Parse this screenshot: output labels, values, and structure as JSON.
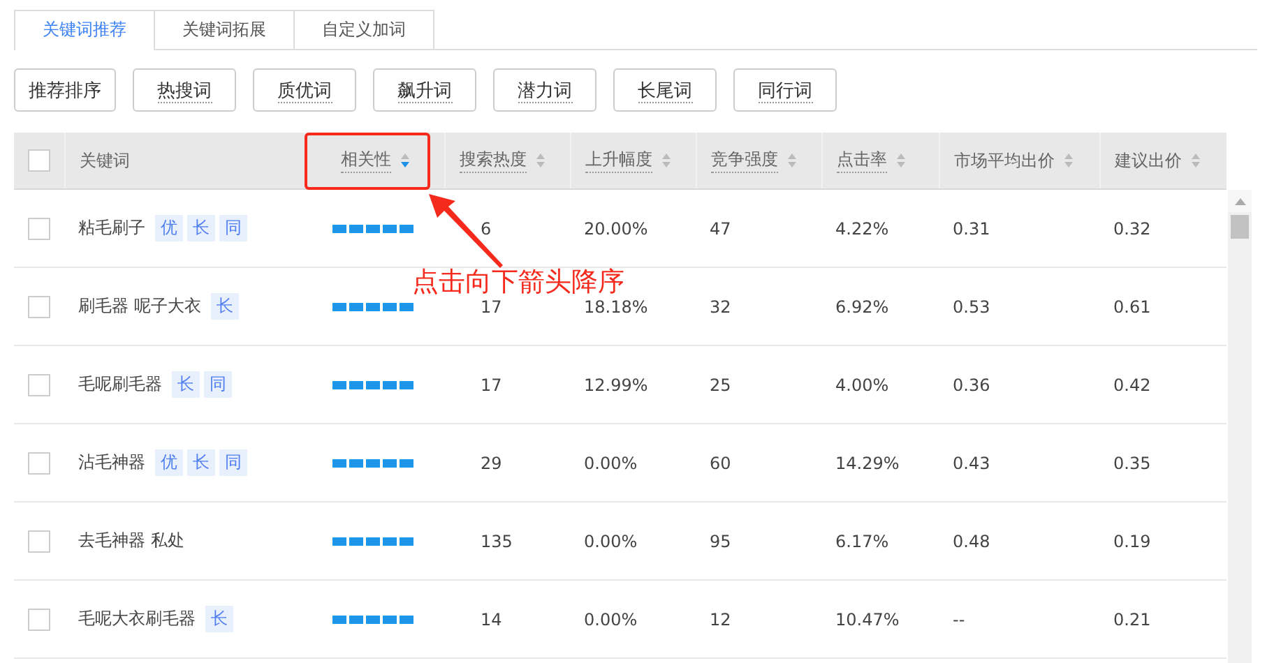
{
  "tabs": [
    {
      "label": "关键词推荐",
      "selected": true
    },
    {
      "label": "关键词拓展",
      "selected": false
    },
    {
      "label": "自定义加词",
      "selected": false
    }
  ],
  "filters": [
    {
      "label": "推荐排序",
      "hint": false
    },
    {
      "label": "热搜词",
      "hint": true
    },
    {
      "label": "质优词",
      "hint": true
    },
    {
      "label": "飙升词",
      "hint": true
    },
    {
      "label": "潜力词",
      "hint": true
    },
    {
      "label": "长尾词",
      "hint": true
    },
    {
      "label": "同行词",
      "hint": true
    }
  ],
  "table": {
    "all_checked": false,
    "columns": [
      {
        "label": "关键词",
        "hint": false,
        "sortable": false
      },
      {
        "label": "相关性",
        "hint": true,
        "sortable": true,
        "sorted_desc": true
      },
      {
        "label": "搜索热度",
        "hint": true,
        "sortable": true,
        "sorted_desc": false
      },
      {
        "label": "上升幅度",
        "hint": true,
        "sortable": true,
        "sorted_desc": false
      },
      {
        "label": "竞争强度",
        "hint": true,
        "sortable": true,
        "sorted_desc": false
      },
      {
        "label": "点击率",
        "hint": true,
        "sortable": true,
        "sorted_desc": false
      },
      {
        "label": "市场平均出价",
        "hint": false,
        "sortable": true,
        "sorted_desc": false
      },
      {
        "label": "建议出价",
        "hint": false,
        "sortable": true,
        "sorted_desc": false
      }
    ],
    "rows": [
      {
        "checked": false,
        "keyword": "粘毛刷子",
        "tags": [
          "优",
          "长",
          "同"
        ],
        "stars": 5,
        "heat": "6",
        "rise": "20.00%",
        "competition": "47",
        "ctr": "4.22%",
        "market_bid": "0.31",
        "suggested_bid": "0.32"
      },
      {
        "checked": false,
        "keyword": "刷毛器 呢子大衣",
        "tags": [
          "长"
        ],
        "stars": 5,
        "heat": "17",
        "rise": "18.18%",
        "competition": "32",
        "ctr": "6.92%",
        "market_bid": "0.53",
        "suggested_bid": "0.61"
      },
      {
        "checked": false,
        "keyword": "毛呢刷毛器",
        "tags": [
          "长",
          "同"
        ],
        "stars": 5,
        "heat": "17",
        "rise": "12.99%",
        "competition": "25",
        "ctr": "4.00%",
        "market_bid": "0.36",
        "suggested_bid": "0.42"
      },
      {
        "checked": false,
        "keyword": "沾毛神器",
        "tags": [
          "优",
          "长",
          "同"
        ],
        "stars": 5,
        "heat": "29",
        "rise": "0.00%",
        "competition": "60",
        "ctr": "14.29%",
        "market_bid": "0.43",
        "suggested_bid": "0.35"
      },
      {
        "checked": false,
        "keyword": "去毛神器 私处",
        "tags": [],
        "stars": 5,
        "heat": "135",
        "rise": "0.00%",
        "competition": "95",
        "ctr": "6.17%",
        "market_bid": "0.48",
        "suggested_bid": "0.19"
      },
      {
        "checked": false,
        "keyword": "毛呢大衣刷毛器",
        "tags": [
          "长"
        ],
        "stars": 5,
        "heat": "14",
        "rise": "0.00%",
        "competition": "12",
        "ctr": "10.47%",
        "market_bid": "--",
        "suggested_bid": "0.21"
      }
    ]
  },
  "annotation": {
    "text": "点击向下箭头降序"
  }
}
